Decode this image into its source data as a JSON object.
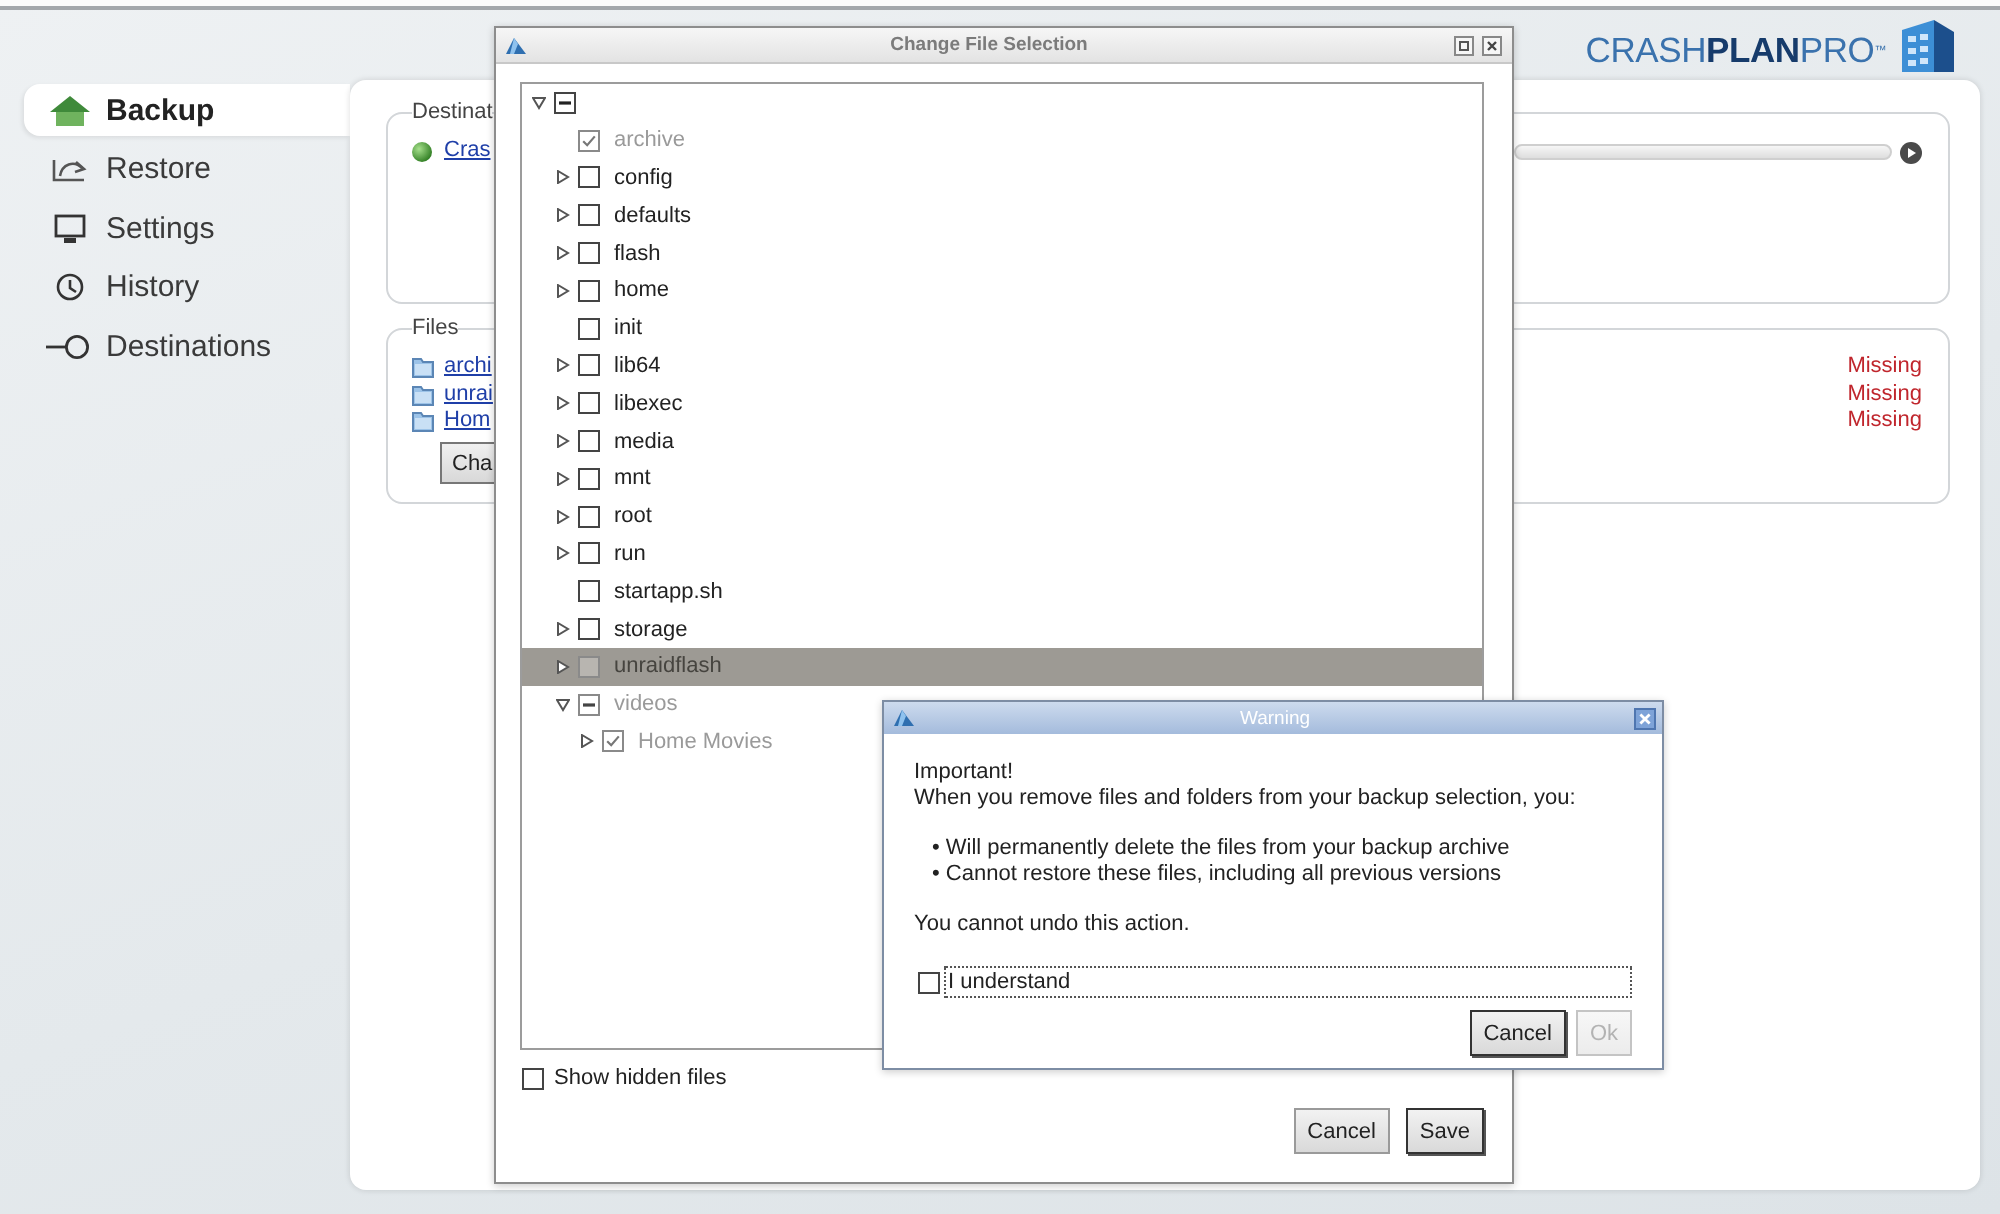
{
  "logo": {
    "text": "CRASH**PLAN**PRO$^{™}$"
  },
  "sidebar": {
    "items": [
      {
        "label": "Backup",
        "selected": true
      },
      {
        "label": "Restore",
        "selected": false
      },
      {
        "label": "Settings",
        "selected": false
      },
      {
        "label": "History",
        "selected": false
      },
      {
        "label": "Destinations",
        "selected": false
      }
    ]
  },
  "destination": {
    "legend": "Destinat",
    "link": "Cras"
  },
  "files": {
    "legend": "Files",
    "items": [
      {
        "name": "archi",
        "status": "Missing"
      },
      {
        "name": "unrai",
        "status": "Missing"
      },
      {
        "name": "Hom",
        "status": "Missing"
      }
    ],
    "button": "Cha"
  },
  "file_dialog": {
    "title": "Change File Selection",
    "tree": {
      "kind": "folder",
      "expanded": true,
      "checked": false,
      "partial": true,
      "selected": false,
      "disabled": false,
      "children": [
        {
          "label": "archive",
          "kind": "file",
          "checked": true,
          "partial": false,
          "selected": false,
          "disabled": true
        },
        {
          "label": "config",
          "kind": "folder",
          "expanded": false,
          "checked": false,
          "partial": false,
          "selected": false,
          "disabled": false
        },
        {
          "label": "defaults",
          "kind": "folder",
          "expanded": false,
          "checked": false,
          "partial": false,
          "selected": false,
          "disabled": false
        },
        {
          "label": "flash",
          "kind": "folder",
          "expanded": false,
          "checked": false,
          "partial": false,
          "selected": false,
          "disabled": false
        },
        {
          "label": "home",
          "kind": "folder",
          "expanded": false,
          "checked": false,
          "partial": false,
          "selected": false,
          "disabled": false
        },
        {
          "label": "init",
          "kind": "file",
          "checked": false,
          "partial": false,
          "selected": false,
          "disabled": false
        },
        {
          "label": "lib64",
          "kind": "folder",
          "expanded": false,
          "checked": false,
          "partial": false,
          "selected": false,
          "disabled": false
        },
        {
          "label": "libexec",
          "kind": "folder",
          "expanded": false,
          "checked": false,
          "partial": false,
          "selected": false,
          "disabled": false
        },
        {
          "label": "media",
          "kind": "folder",
          "expanded": false,
          "checked": false,
          "partial": false,
          "selected": false,
          "disabled": false
        },
        {
          "label": "mnt",
          "kind": "folder",
          "expanded": false,
          "checked": false,
          "partial": false,
          "selected": false,
          "disabled": false
        },
        {
          "label": "root",
          "kind": "folder",
          "expanded": false,
          "checked": false,
          "partial": false,
          "selected": false,
          "disabled": false
        },
        {
          "label": "run",
          "kind": "folder",
          "expanded": false,
          "checked": false,
          "partial": false,
          "selected": false,
          "disabled": false
        },
        {
          "label": "startapp.sh",
          "kind": "file",
          "checked": false,
          "partial": false,
          "selected": false,
          "disabled": false
        },
        {
          "label": "storage",
          "kind": "folder",
          "expanded": false,
          "checked": false,
          "partial": false,
          "selected": false,
          "disabled": false
        },
        {
          "label": "unraidflash",
          "kind": "folder",
          "expanded": false,
          "checked": false,
          "partial": false,
          "selected": true,
          "disabled": true
        },
        {
          "label": "videos",
          "kind": "folder",
          "expanded": true,
          "checked": false,
          "partial": true,
          "selected": false,
          "disabled": true,
          "children": [
            {
              "label": "Home Movies",
              "kind": "folder",
              "expanded": false,
              "checked": true,
              "partial": false,
              "selected": false,
              "disabled": true
            }
          ]
        }
      ]
    },
    "show_hidden": {
      "label": "Show hidden files",
      "checked": false
    },
    "buttons": [
      {
        "label": "Cancel",
        "default": false
      },
      {
        "label": "Save",
        "default": true
      }
    ]
  },
  "warning": {
    "title": "Warning",
    "heading": "Important!",
    "intro": "When you remove files and folders from your backup selection, you:",
    "bullets": [
      "• Will permanently delete the files from your backup archive",
      "• Cannot restore these files, including all previous versions"
    ],
    "note": "You cannot undo this action.",
    "confirm": {
      "label": "I understand",
      "checked": false
    },
    "buttons": [
      {
        "label": "Cancel",
        "default": true,
        "disabled": false
      },
      {
        "label": "Ok",
        "default": false,
        "disabled": true
      }
    ]
  }
}
